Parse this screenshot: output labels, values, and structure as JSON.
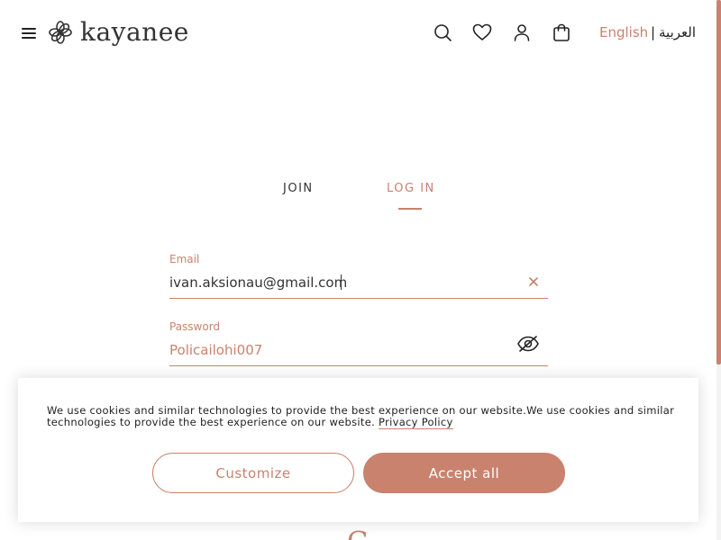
{
  "brand": {
    "name": "kayanee",
    "accent": "#c8826d"
  },
  "header": {
    "icons": [
      "menu-icon",
      "search-icon",
      "heart-icon",
      "user-icon",
      "bag-icon"
    ],
    "lang_en": "English",
    "lang_sep": "|",
    "lang_ar": "العربية"
  },
  "tabs": {
    "join": "JOIN",
    "login": "LOG IN",
    "active": "login"
  },
  "form": {
    "email_label": "Email",
    "email_value": "ivan.aksionau@gmail.com",
    "password_label": "Password",
    "password_value": "Policailohi007"
  },
  "cookie": {
    "text": "We use cookies and similar technologies to provide the best experience on our website.We use cookies and similar technologies to provide the best experience on our website.",
    "link": "Privacy Policy",
    "customize": "Customize",
    "accept": "Accept all"
  }
}
